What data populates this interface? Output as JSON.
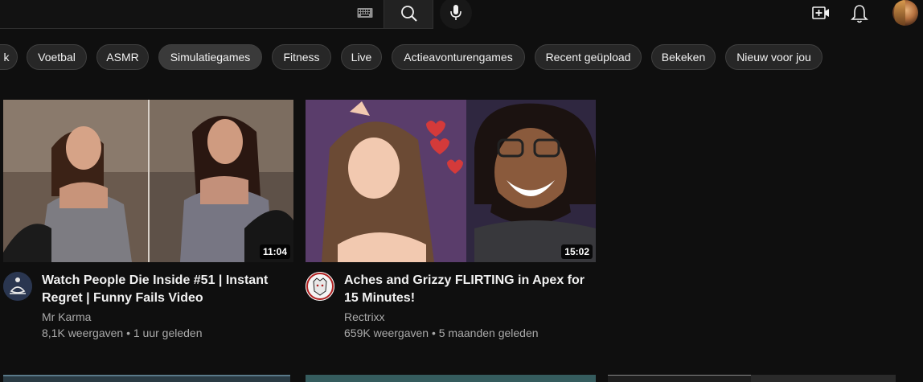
{
  "header": {
    "icons": [
      "keyboard-icon",
      "search-icon",
      "mic-icon",
      "create-icon",
      "bell-icon"
    ]
  },
  "chips": [
    {
      "label": "k"
    },
    {
      "label": "Voetbal"
    },
    {
      "label": "ASMR"
    },
    {
      "label": "Simulatiegames"
    },
    {
      "label": "Fitness"
    },
    {
      "label": "Live"
    },
    {
      "label": "Actieavonturengames"
    },
    {
      "label": "Recent geüpload"
    },
    {
      "label": "Bekeken"
    },
    {
      "label": "Nieuw voor jou"
    }
  ],
  "videos": [
    {
      "title": "Watch People Die Inside #51 | Instant Regret | Funny Fails Video",
      "channel": "Mr Karma",
      "meta": "8,1K weergaven • 1 uur geleden",
      "duration": "11:04"
    },
    {
      "title": "Aches and Grizzy FLIRTING in Apex for 15 Minutes!",
      "channel": "Rectrixx",
      "meta": "659K weergaven • 5 maanden geleden",
      "duration": "15:02"
    }
  ],
  "colors": {
    "background": "#0f0f0f",
    "chip_bg": "#272727",
    "text_primary": "#f1f1f1",
    "text_secondary": "#aaaaaa"
  }
}
